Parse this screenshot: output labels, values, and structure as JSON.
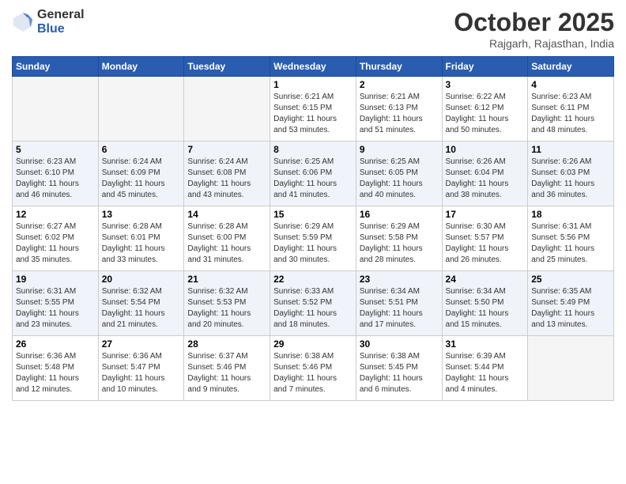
{
  "logo": {
    "general": "General",
    "blue": "Blue"
  },
  "header": {
    "month": "October 2025",
    "location": "Rajgarh, Rajasthan, India"
  },
  "weekdays": [
    "Sunday",
    "Monday",
    "Tuesday",
    "Wednesday",
    "Thursday",
    "Friday",
    "Saturday"
  ],
  "weeks": [
    [
      {
        "day": "",
        "info": ""
      },
      {
        "day": "",
        "info": ""
      },
      {
        "day": "",
        "info": ""
      },
      {
        "day": "1",
        "info": "Sunrise: 6:21 AM\nSunset: 6:15 PM\nDaylight: 11 hours\nand 53 minutes."
      },
      {
        "day": "2",
        "info": "Sunrise: 6:21 AM\nSunset: 6:13 PM\nDaylight: 11 hours\nand 51 minutes."
      },
      {
        "day": "3",
        "info": "Sunrise: 6:22 AM\nSunset: 6:12 PM\nDaylight: 11 hours\nand 50 minutes."
      },
      {
        "day": "4",
        "info": "Sunrise: 6:23 AM\nSunset: 6:11 PM\nDaylight: 11 hours\nand 48 minutes."
      }
    ],
    [
      {
        "day": "5",
        "info": "Sunrise: 6:23 AM\nSunset: 6:10 PM\nDaylight: 11 hours\nand 46 minutes."
      },
      {
        "day": "6",
        "info": "Sunrise: 6:24 AM\nSunset: 6:09 PM\nDaylight: 11 hours\nand 45 minutes."
      },
      {
        "day": "7",
        "info": "Sunrise: 6:24 AM\nSunset: 6:08 PM\nDaylight: 11 hours\nand 43 minutes."
      },
      {
        "day": "8",
        "info": "Sunrise: 6:25 AM\nSunset: 6:06 PM\nDaylight: 11 hours\nand 41 minutes."
      },
      {
        "day": "9",
        "info": "Sunrise: 6:25 AM\nSunset: 6:05 PM\nDaylight: 11 hours\nand 40 minutes."
      },
      {
        "day": "10",
        "info": "Sunrise: 6:26 AM\nSunset: 6:04 PM\nDaylight: 11 hours\nand 38 minutes."
      },
      {
        "day": "11",
        "info": "Sunrise: 6:26 AM\nSunset: 6:03 PM\nDaylight: 11 hours\nand 36 minutes."
      }
    ],
    [
      {
        "day": "12",
        "info": "Sunrise: 6:27 AM\nSunset: 6:02 PM\nDaylight: 11 hours\nand 35 minutes."
      },
      {
        "day": "13",
        "info": "Sunrise: 6:28 AM\nSunset: 6:01 PM\nDaylight: 11 hours\nand 33 minutes."
      },
      {
        "day": "14",
        "info": "Sunrise: 6:28 AM\nSunset: 6:00 PM\nDaylight: 11 hours\nand 31 minutes."
      },
      {
        "day": "15",
        "info": "Sunrise: 6:29 AM\nSunset: 5:59 PM\nDaylight: 11 hours\nand 30 minutes."
      },
      {
        "day": "16",
        "info": "Sunrise: 6:29 AM\nSunset: 5:58 PM\nDaylight: 11 hours\nand 28 minutes."
      },
      {
        "day": "17",
        "info": "Sunrise: 6:30 AM\nSunset: 5:57 PM\nDaylight: 11 hours\nand 26 minutes."
      },
      {
        "day": "18",
        "info": "Sunrise: 6:31 AM\nSunset: 5:56 PM\nDaylight: 11 hours\nand 25 minutes."
      }
    ],
    [
      {
        "day": "19",
        "info": "Sunrise: 6:31 AM\nSunset: 5:55 PM\nDaylight: 11 hours\nand 23 minutes."
      },
      {
        "day": "20",
        "info": "Sunrise: 6:32 AM\nSunset: 5:54 PM\nDaylight: 11 hours\nand 21 minutes."
      },
      {
        "day": "21",
        "info": "Sunrise: 6:32 AM\nSunset: 5:53 PM\nDaylight: 11 hours\nand 20 minutes."
      },
      {
        "day": "22",
        "info": "Sunrise: 6:33 AM\nSunset: 5:52 PM\nDaylight: 11 hours\nand 18 minutes."
      },
      {
        "day": "23",
        "info": "Sunrise: 6:34 AM\nSunset: 5:51 PM\nDaylight: 11 hours\nand 17 minutes."
      },
      {
        "day": "24",
        "info": "Sunrise: 6:34 AM\nSunset: 5:50 PM\nDaylight: 11 hours\nand 15 minutes."
      },
      {
        "day": "25",
        "info": "Sunrise: 6:35 AM\nSunset: 5:49 PM\nDaylight: 11 hours\nand 13 minutes."
      }
    ],
    [
      {
        "day": "26",
        "info": "Sunrise: 6:36 AM\nSunset: 5:48 PM\nDaylight: 11 hours\nand 12 minutes."
      },
      {
        "day": "27",
        "info": "Sunrise: 6:36 AM\nSunset: 5:47 PM\nDaylight: 11 hours\nand 10 minutes."
      },
      {
        "day": "28",
        "info": "Sunrise: 6:37 AM\nSunset: 5:46 PM\nDaylight: 11 hours\nand 9 minutes."
      },
      {
        "day": "29",
        "info": "Sunrise: 6:38 AM\nSunset: 5:46 PM\nDaylight: 11 hours\nand 7 minutes."
      },
      {
        "day": "30",
        "info": "Sunrise: 6:38 AM\nSunset: 5:45 PM\nDaylight: 11 hours\nand 6 minutes."
      },
      {
        "day": "31",
        "info": "Sunrise: 6:39 AM\nSunset: 5:44 PM\nDaylight: 11 hours\nand 4 minutes."
      },
      {
        "day": "",
        "info": ""
      }
    ]
  ]
}
